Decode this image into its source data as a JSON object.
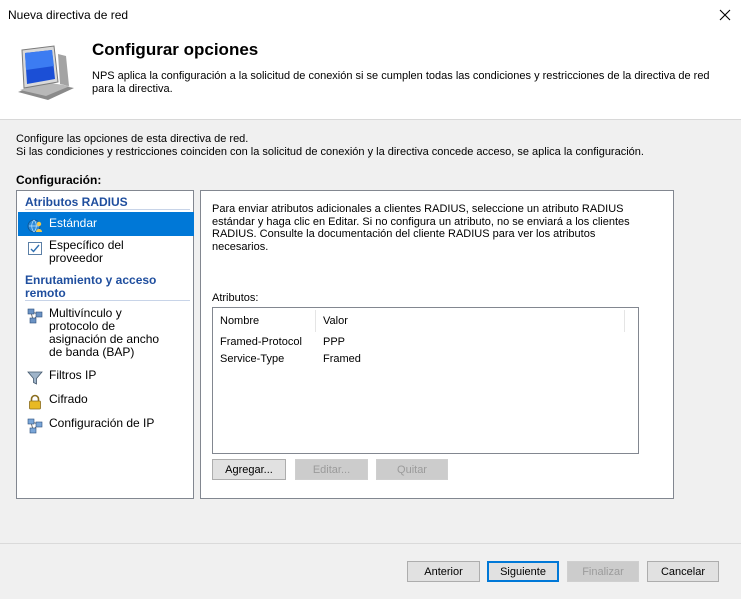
{
  "window": {
    "title": "Nueva directiva de red",
    "close_glyph": "✕"
  },
  "header": {
    "title": "Configurar opciones",
    "description": "NPS aplica la configuración a la solicitud de conexión si se cumplen todas las condiciones y restricciones de la directiva de red para la directiva.",
    "icon": "computer-monitor-icon"
  },
  "intro": {
    "line1": "Configure las opciones de esta directiva de red.",
    "line2": "Si las condiciones y restricciones coinciden con la solicitud de conexión y la directiva concede acceso, se aplica la configuración."
  },
  "config_label": "Configuración:",
  "sidebar": {
    "groups": [
      {
        "heading": "Atributos RADIUS",
        "items": [
          {
            "label": "Estándar",
            "icon": "globe-user-icon",
            "selected": true
          },
          {
            "label": "Específico del proveedor",
            "icon": "checklist-icon",
            "selected": false
          }
        ]
      },
      {
        "heading": "Enrutamiento y acceso remoto",
        "items": [
          {
            "label": "Multivínculo y protocolo de asignación de ancho de banda (BAP)",
            "icon": "network-nodes-icon",
            "selected": false
          },
          {
            "label": "Filtros IP",
            "icon": "funnel-icon",
            "selected": false
          },
          {
            "label": "Cifrado",
            "icon": "padlock-icon",
            "selected": false
          },
          {
            "label": "Configuración de IP",
            "icon": "network-computers-icon",
            "selected": false
          }
        ]
      }
    ]
  },
  "main": {
    "description": "Para enviar atributos adicionales a clientes RADIUS, seleccione un atributo RADIUS estándar y haga clic en Editar. Si no configura un atributo, no se enviará a los clientes RADIUS. Consulte la documentación del cliente RADIUS para ver los atributos necesarios.",
    "attributes_label": "Atributos:",
    "columns": [
      "Nombre",
      "Valor"
    ],
    "rows": [
      {
        "name": "Framed-Protocol",
        "value": "PPP"
      },
      {
        "name": "Service-Type",
        "value": "Framed"
      }
    ],
    "buttons": {
      "add": "Agregar...",
      "edit": "Editar...",
      "remove": "Quitar"
    }
  },
  "footer": {
    "back": "Anterior",
    "next": "Siguiente",
    "finish": "Finalizar",
    "cancel": "Cancelar"
  },
  "colors": {
    "selection": "#0078d7",
    "group_heading": "#1f4e9e"
  }
}
